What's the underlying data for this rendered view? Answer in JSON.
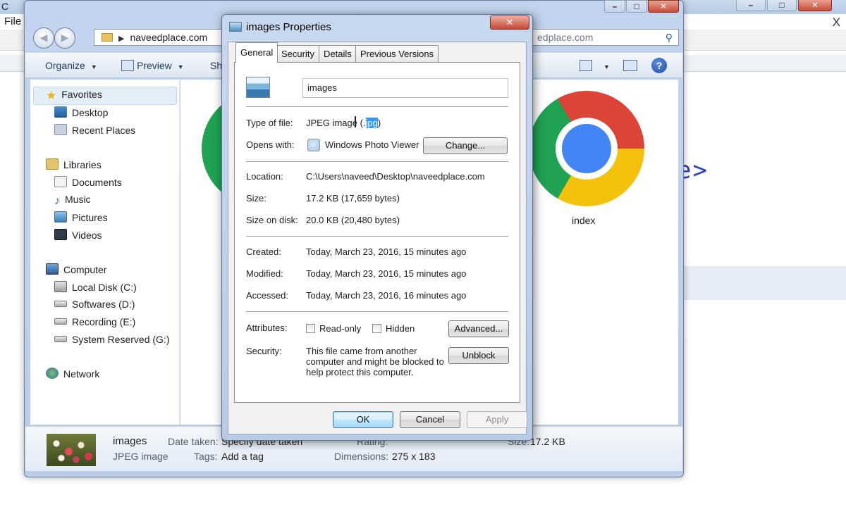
{
  "background_app": {
    "title_fragment": "C",
    "menu": [
      "File"
    ],
    "close_glyph": "X",
    "code_fragment": "e>",
    "colors": {
      "code": "#2b3fc8"
    }
  },
  "explorer": {
    "address": {
      "path": "naveedplace.com"
    },
    "search": {
      "placeholder": "edplace.com"
    },
    "toolbar": {
      "organize": "Organize",
      "preview": "Preview",
      "share_fragment": "Sh"
    },
    "nav": {
      "favorites": "Favorites",
      "desktop": "Desktop",
      "recent_places": "Recent Places",
      "libraries": "Libraries",
      "documents": "Documents",
      "music": "Music",
      "pictures": "Pictures",
      "videos": "Videos",
      "computer": "Computer",
      "local_disk": "Local Disk (C:)",
      "softwares": "Softwares (D:)",
      "recording": "Recording (E:)",
      "system_reserved": "System Reserved (G:)",
      "network": "Network"
    },
    "content": {
      "items": [
        {
          "label": "index",
          "icon": "chrome-icon"
        }
      ]
    },
    "details": {
      "name": "images",
      "type": "JPEG image",
      "date_taken_label": "Date taken:",
      "date_taken_value": "Specify date taken",
      "tags_label": "Tags:",
      "tags_value": "Add a tag",
      "rating_label": "Rating:",
      "dimensions_label": "Dimensions:",
      "dimensions_value": "275 x 183",
      "size_label": "Size:",
      "size_value": "17.2 KB"
    }
  },
  "dialog": {
    "title": "images Properties",
    "close_glyph": "✕",
    "tabs": [
      "General",
      "Security",
      "Details",
      "Previous Versions"
    ],
    "active_tab": "General",
    "file_name": "images",
    "type_of_file": {
      "label": "Type of file:",
      "value_prefix": "JPEG image (.",
      "value_selected": "jpg",
      "value_suffix": ")"
    },
    "opens_with": {
      "label": "Opens with:",
      "value": "Windows Photo Viewer",
      "change_button": "Change..."
    },
    "location": {
      "label": "Location:",
      "value": "C:\\Users\\naveed\\Desktop\\naveedplace.com"
    },
    "size": {
      "label": "Size:",
      "value": "17.2 KB (17,659 bytes)"
    },
    "size_on_disk": {
      "label": "Size on disk:",
      "value": "20.0 KB (20,480 bytes)"
    },
    "created": {
      "label": "Created:",
      "value": "Today, March 23, 2016, 15 minutes ago"
    },
    "modified": {
      "label": "Modified:",
      "value": "Today, March 23, 2016, 15 minutes ago"
    },
    "accessed": {
      "label": "Accessed:",
      "value": "Today, March 23, 2016, 16 minutes ago"
    },
    "attributes": {
      "label": "Attributes:",
      "read_only": "Read-only",
      "hidden": "Hidden",
      "advanced_button": "Advanced..."
    },
    "security": {
      "label": "Security:",
      "line1": "This file came from another",
      "line2": "computer and might be blocked to",
      "line3": "help protect this computer.",
      "unblock_button": "Unblock"
    },
    "buttons": {
      "ok": "OK",
      "cancel": "Cancel",
      "apply": "Apply"
    }
  }
}
